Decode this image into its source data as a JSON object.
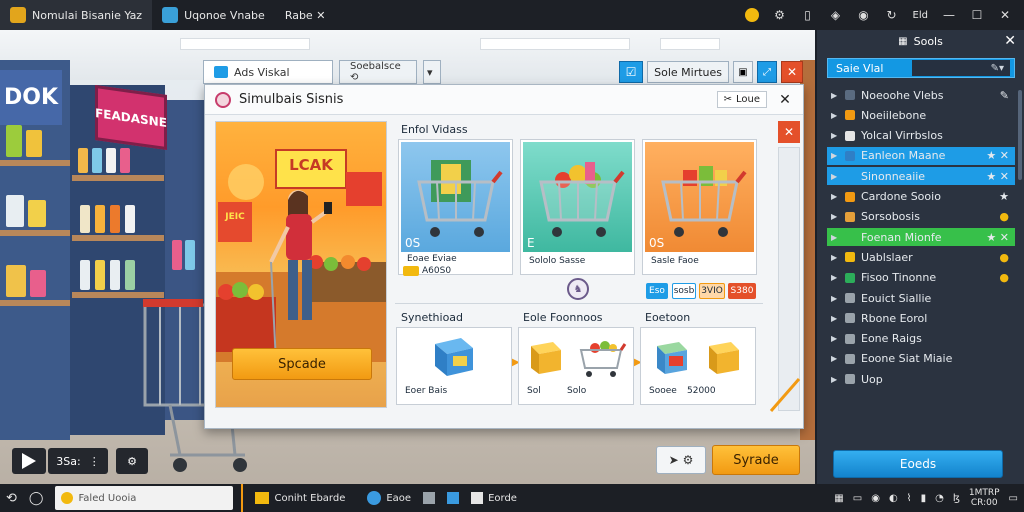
{
  "window": {
    "tabs": [
      {
        "label": "Nomulai Bisanie  Yaz"
      },
      {
        "label": "Uqonoe Vnabe"
      },
      {
        "label": "Rabe ✕"
      }
    ],
    "icons": [
      "coin-icon",
      "gear-icon",
      "phone-icon",
      "shield-icon",
      "globe-icon",
      "refresh-icon",
      "minimize-icon",
      "maximize-icon",
      "close-icon"
    ],
    "right_label": "Eld"
  },
  "scene": {
    "sign_left": "DOK",
    "sign_red": "FEADASNE",
    "time_display": "3Sa:"
  },
  "dialog": {
    "tabs": [
      {
        "label": "Ads Viskal"
      },
      {
        "label": "Soebalsce ⟲"
      }
    ],
    "tab_right": "Sole Mirtues",
    "title": "Simulbais Sisnis",
    "close_label": "Loue",
    "hero": {
      "sign_top": "LCAK",
      "sign_side": "JEIC",
      "button": "Spcade"
    },
    "section1_title": "Enfol Vidass",
    "cards": [
      {
        "badge": "0S",
        "line1": "Eoae Eviae",
        "line2": "A60S0"
      },
      {
        "badge": "E",
        "line1": "Sololo Sasse",
        "line2": ""
      },
      {
        "badge": "0S",
        "line1": "Sasle Faoe",
        "line2": ""
      }
    ],
    "chips": [
      "Eso",
      "sosb",
      "3VIO",
      "S380"
    ],
    "section2": [
      {
        "title": "Synethioad",
        "line1": "Eoer Bais",
        "line2": ""
      },
      {
        "title": "Eole Foonnoos",
        "line1": "Sol",
        "line2": "Solo"
      },
      {
        "title": "Eoetoon",
        "line1": "Sooee",
        "line2": "52000"
      }
    ],
    "bottom_button": "Syrade"
  },
  "panel": {
    "title": "Sools",
    "search_label": "Saie Vlal",
    "search_value": "",
    "items": [
      {
        "label": "Noeoohe Vlebs",
        "tail": "✎",
        "style": ""
      },
      {
        "label": "Noeiilebone",
        "tail": "",
        "style": ""
      },
      {
        "label": "Yolcal Virrbslos",
        "tail": "",
        "style": ""
      },
      {
        "label": "Eanleon Maane",
        "tail": "★ ✕",
        "style": "blue"
      },
      {
        "label": "Sinonneaiie",
        "tail": "★ ✕",
        "style": "blue"
      },
      {
        "label": "Cardone Sooio",
        "tail": "★",
        "style": ""
      },
      {
        "label": "Sorsobosis",
        "tail": "●",
        "style": ""
      },
      {
        "label": "Foenan Mionfe",
        "tail": "★ ✕",
        "style": "green"
      },
      {
        "label": "Uablslaer",
        "tail": "●",
        "style": ""
      },
      {
        "label": "Fisoo Tinonne",
        "tail": "●",
        "style": ""
      },
      {
        "label": "Eouict Siallie",
        "tail": "",
        "style": ""
      },
      {
        "label": "Rbone Eorol",
        "tail": "",
        "style": ""
      },
      {
        "label": "Eone Raigs",
        "tail": "",
        "style": ""
      },
      {
        "label": "Eoone Siat Miaie",
        "tail": "",
        "style": ""
      },
      {
        "label": "Uop",
        "tail": "",
        "style": ""
      }
    ],
    "button": "Eoeds"
  },
  "taskbar": {
    "search": "Faled Uooia",
    "apps": [
      {
        "label": "Coniht Ebarde"
      },
      {
        "label": "Eaoe"
      },
      {
        "label": ""
      },
      {
        "label": ""
      },
      {
        "label": "Eorde"
      }
    ],
    "clock_line1": "1MTRP",
    "clock_line2": "CR:00"
  },
  "colors": {
    "accent_blue": "#1e9ce6",
    "accent_green": "#37c04a",
    "accent_orange": "#f29a12",
    "close_red": "#e4502a"
  }
}
